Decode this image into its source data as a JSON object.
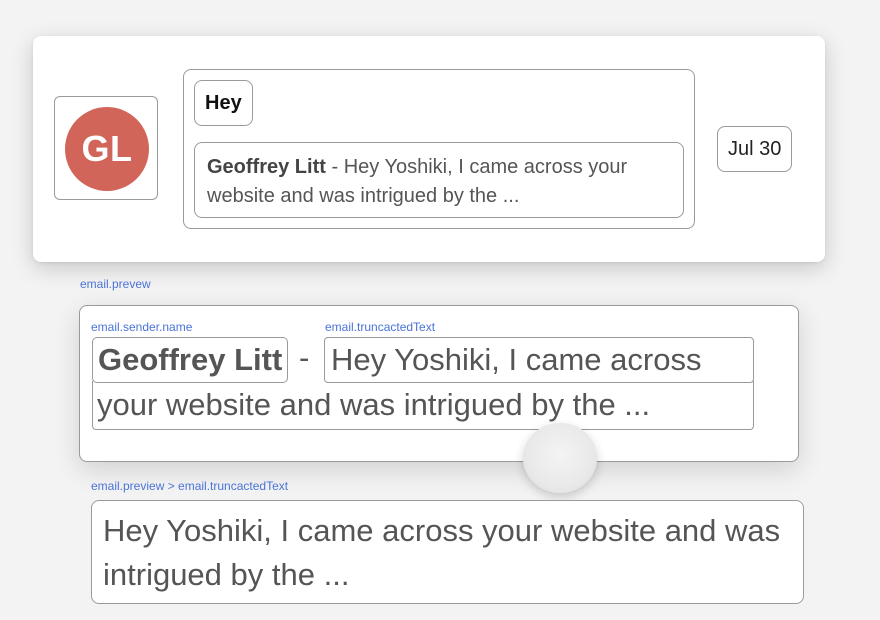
{
  "email": {
    "avatar_initials": "GL",
    "avatar_color": "#d2655a",
    "subject": "Hey",
    "sender_name": "Geoffrey Litt",
    "separator": "-",
    "truncated_text": "Hey Yoshiki, I came across your website and was intrigued by the ...",
    "date": "Jul 30"
  },
  "zoom": {
    "truncated_line1": "Hey Yoshiki, I came across",
    "truncated_line2": "your website and was intrigued by the ..."
  },
  "labels": {
    "preview": "email.prevew",
    "sender_name": "email.sender.name",
    "truncated_text": "email.truncactedText",
    "path": "email.preview > email.truncactedText"
  },
  "colors": {
    "label_blue": "#4a73d9"
  }
}
